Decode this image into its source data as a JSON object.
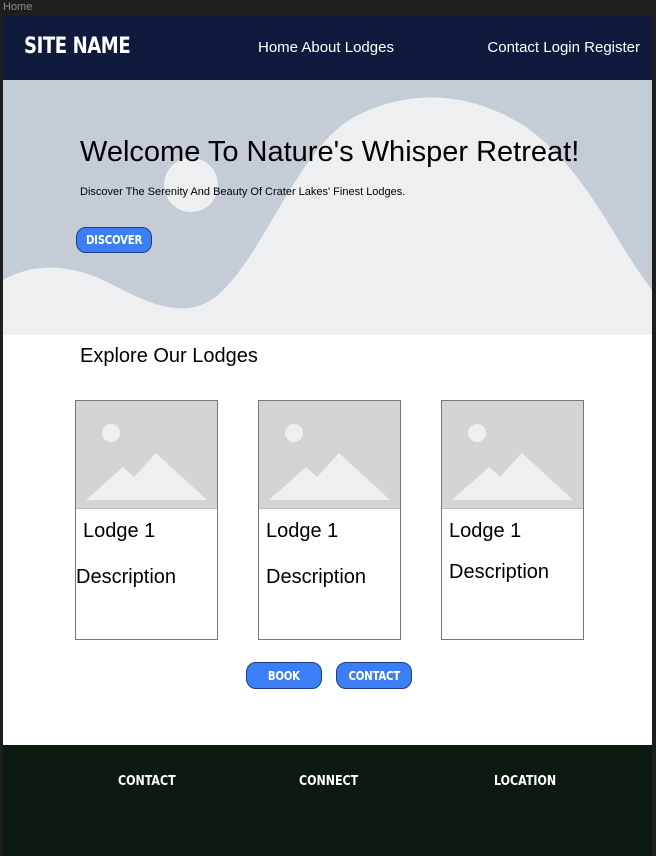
{
  "frame_label": "Home",
  "nav": {
    "site_name": "SITE NAME",
    "links_center": [
      "Home",
      "About",
      "Lodges"
    ],
    "links_right": [
      "Contact",
      "Login",
      "Register"
    ]
  },
  "hero": {
    "title": "Welcome To Nature's Whisper Retreat!",
    "subtitle": "Discover The Serenity And Beauty Of Crater Lakes' Finest Lodges.",
    "button_label": "DISCOVER"
  },
  "lodges": {
    "title": "Explore Our Lodges",
    "cards": [
      {
        "title": "Lodge 1",
        "description": "Description",
        "image_icon": "image-placeholder-icon"
      },
      {
        "title": "Lodge 1",
        "description": "Description",
        "image_icon": "image-placeholder-icon"
      },
      {
        "title": "Lodge 1",
        "description": "Description",
        "image_icon": "image-placeholder-icon"
      }
    ],
    "book_label": "BOOK",
    "contact_label": "CONTACT"
  },
  "footer": {
    "contact": "CONTACT",
    "connect": "CONNECT",
    "location": "LOCATION"
  },
  "colors": {
    "nav_bg": "#0f1a3d",
    "button_accent": "#3b7ef6",
    "footer_bg": "#0c1a10",
    "hero_shape": "#c4cdd6"
  }
}
